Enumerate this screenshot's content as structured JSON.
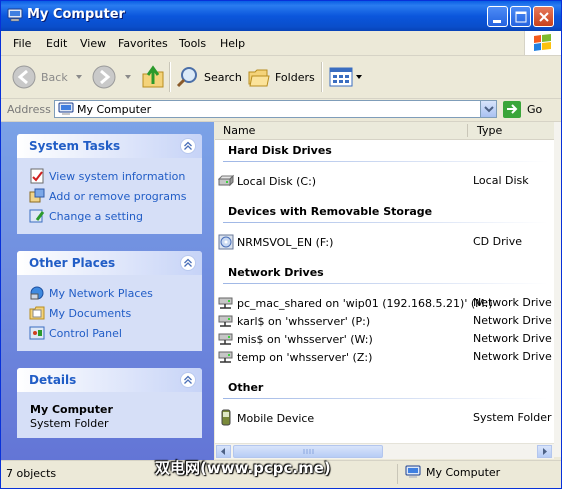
{
  "window": {
    "title": "My Computer"
  },
  "menu": [
    "File",
    "Edit",
    "View",
    "Favorites",
    "Tools",
    "Help"
  ],
  "toolbar": {
    "back_label": "Back",
    "search_label": "Search",
    "folders_label": "Folders"
  },
  "address": {
    "label": "Address",
    "value": "My Computer",
    "go_label": "Go"
  },
  "panels": {
    "system_tasks": {
      "title": "System Tasks",
      "items": [
        "View system information",
        "Add or remove programs",
        "Change a setting"
      ]
    },
    "other_places": {
      "title": "Other Places",
      "items": [
        "My Network Places",
        "My Documents",
        "Control Panel"
      ]
    },
    "details": {
      "title": "Details",
      "name": "My Computer",
      "type": "System Folder"
    }
  },
  "columns": {
    "name": "Name",
    "type": "Type"
  },
  "groups": [
    {
      "title": "Hard Disk Drives",
      "items": [
        {
          "name": "Local Disk (C:)",
          "type": "Local Disk",
          "icon": "hard-disk-icon"
        }
      ]
    },
    {
      "title": "Devices with Removable Storage",
      "items": [
        {
          "name": "NRMSVOL_EN (F:)",
          "type": "CD Drive",
          "icon": "cd-drive-icon"
        }
      ]
    },
    {
      "title": "Network Drives",
      "items": [
        {
          "name": "pc_mac_shared on 'wip01 (192.168.5.21)' (M:)",
          "type": "Network Drive",
          "icon": "network-drive-icon"
        },
        {
          "name": "karl$ on 'whsserver' (P:)",
          "type": "Network Drive",
          "icon": "network-drive-icon"
        },
        {
          "name": "mis$ on 'whsserver' (W:)",
          "type": "Network Drive",
          "icon": "network-drive-icon"
        },
        {
          "name": "temp on 'whsserver' (Z:)",
          "type": "Network Drive",
          "icon": "network-drive-icon"
        }
      ]
    },
    {
      "title": "Other",
      "items": [
        {
          "name": "Mobile Device",
          "type": "System Folder",
          "icon": "mobile-device-icon"
        }
      ]
    }
  ],
  "status": {
    "objects": "7 objects",
    "location": "My Computer"
  },
  "watermark": "双电网(www.pcpc.me)"
}
